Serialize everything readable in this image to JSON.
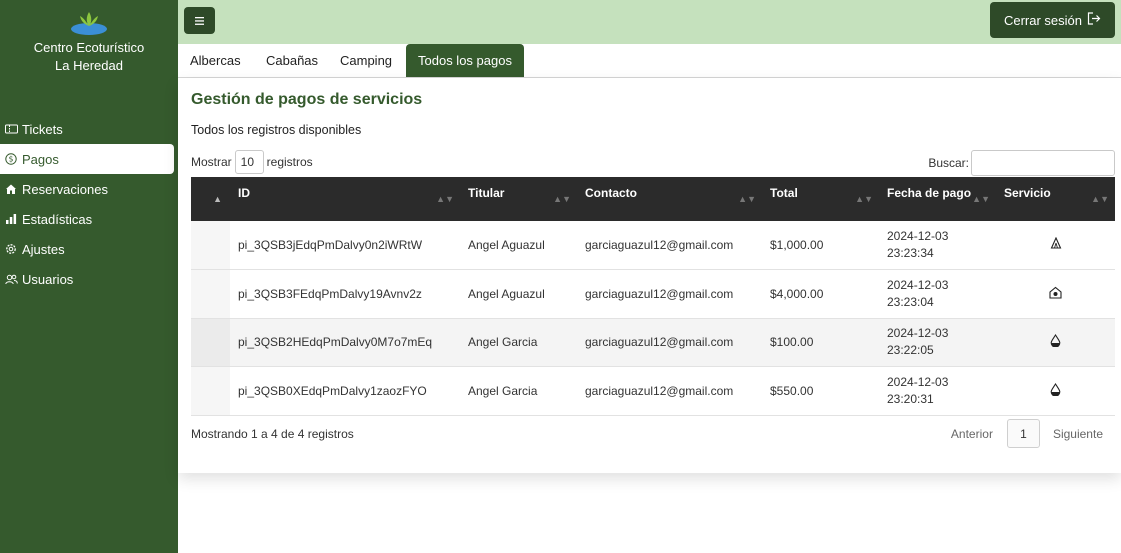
{
  "brand": {
    "line1": "Centro Ecoturístico",
    "line2": "La Heredad"
  },
  "sidebar": {
    "items": [
      {
        "label": "Tickets",
        "icon": "ticket-icon"
      },
      {
        "label": "Pagos",
        "icon": "dollar-circle-icon",
        "active": true
      },
      {
        "label": "Reservaciones",
        "icon": "house-icon"
      },
      {
        "label": "Estadísticas",
        "icon": "bar-chart-icon"
      },
      {
        "label": "Ajustes",
        "icon": "gear-icon"
      },
      {
        "label": "Usuarios",
        "icon": "users-icon"
      }
    ]
  },
  "topbar": {
    "menu_icon": "menu-icon",
    "logout_label": "Cerrar sesión",
    "logout_icon": "logout-icon"
  },
  "tabs": [
    {
      "label": "Albercas"
    },
    {
      "label": "Cabañas"
    },
    {
      "label": "Camping"
    },
    {
      "label": "Todos los pagos",
      "active": true
    }
  ],
  "main": {
    "title": "Gestión de pagos de servicios",
    "subtitle": "Todos los registros disponibles",
    "length_prefix": "Mostrar",
    "length_value": "10",
    "length_suffix": "registros",
    "search_label": "Buscar:",
    "search_value": ""
  },
  "table": {
    "columns": [
      "",
      "ID",
      "Titular",
      "Contacto",
      "Total",
      "Fecha de pago",
      "Servicio"
    ],
    "rows": [
      {
        "id": "pi_3QSB3jEdqPmDalvy0n2iWRtW",
        "titular": "Angel Aguazul",
        "contacto": "garciaguazul12@gmail.com",
        "total": "$1,000.00",
        "fecha": "2024-12-03",
        "hora": "23:23:34",
        "servicio_icon": "tent-icon"
      },
      {
        "id": "pi_3QSB3FEdqPmDalvy19Avnv2z",
        "titular": "Angel Aguazul",
        "contacto": "garciaguazul12@gmail.com",
        "total": "$4,000.00",
        "fecha": "2024-12-03",
        "hora": "23:23:04",
        "servicio_icon": "cabin-icon"
      },
      {
        "id": "pi_3QSB2HEdqPmDalvy0M7o7mEq",
        "titular": "Angel Garcia",
        "contacto": "garciaguazul12@gmail.com",
        "total": "$100.00",
        "fecha": "2024-12-03",
        "hora": "23:22:05",
        "servicio_icon": "water-drop-icon"
      },
      {
        "id": "pi_3QSB0XEdqPmDalvy1zaozFYO",
        "titular": "Angel Garcia",
        "contacto": "garciaguazul12@gmail.com",
        "total": "$550.00",
        "fecha": "2024-12-03",
        "hora": "23:20:31",
        "servicio_icon": "water-drop-icon"
      }
    ]
  },
  "footer": {
    "info": "Mostrando 1 a 4 de 4 registros",
    "prev_label": "Anterior",
    "page": "1",
    "next_label": "Siguiente"
  },
  "colors": {
    "sidebar": "#355a2d",
    "topbar": "#c5e1bd",
    "button": "#2e4a28",
    "table_header": "#2b2b2b"
  }
}
